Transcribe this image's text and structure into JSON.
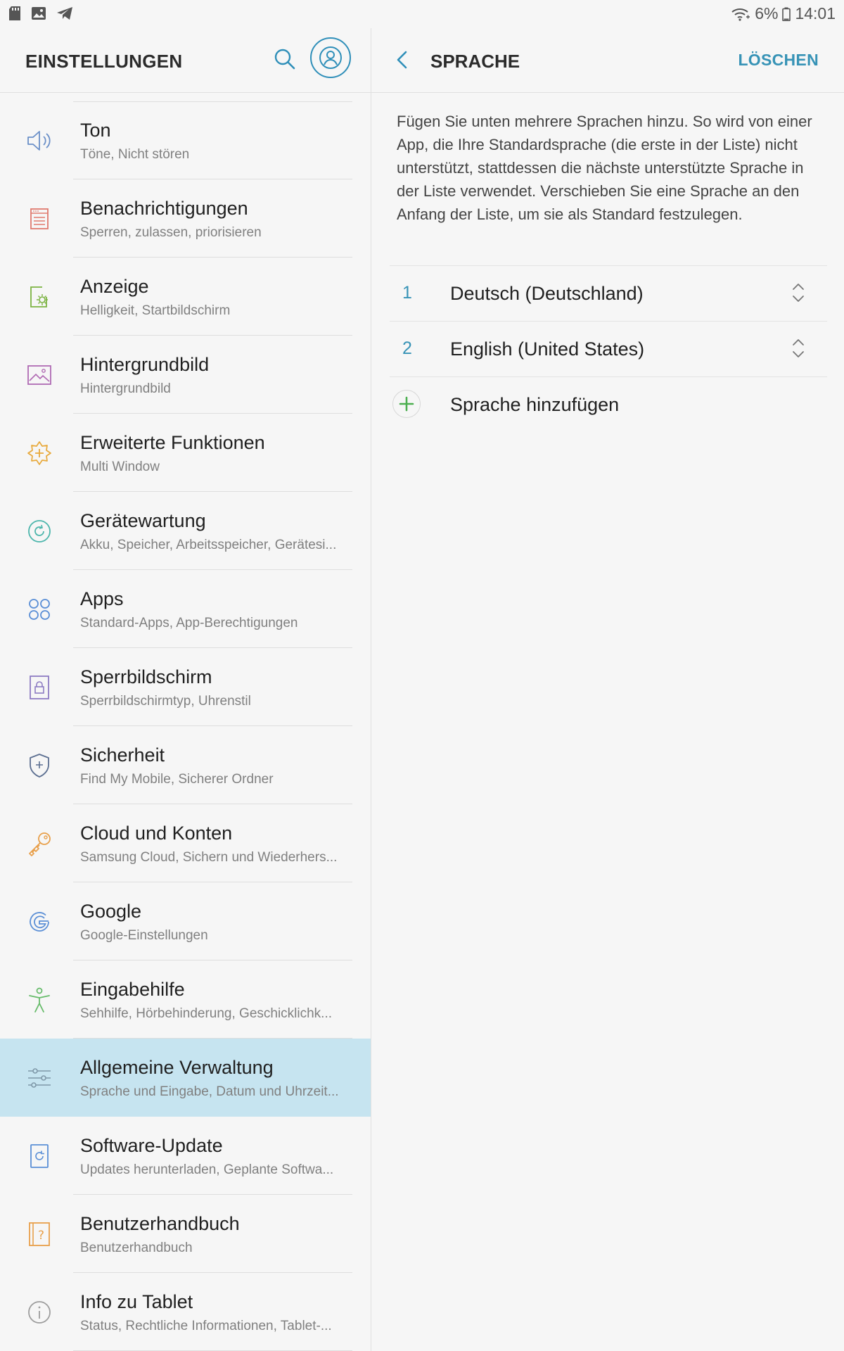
{
  "status_bar": {
    "battery": "6%",
    "time": "14:01",
    "left_icons": [
      "sd-card-icon",
      "gallery-icon",
      "telegram-icon"
    ]
  },
  "left_pane": {
    "title": "EINSTELLUNGEN",
    "items": [
      {
        "title": "Ton",
        "subtitle": "Töne, Nicht stören",
        "icon": "speaker-icon"
      },
      {
        "title": "Benachrichtigungen",
        "subtitle": "Sperren, zulassen, priorisieren",
        "icon": "notification-icon"
      },
      {
        "title": "Anzeige",
        "subtitle": "Helligkeit, Startbildschirm",
        "icon": "display-brightness-icon"
      },
      {
        "title": "Hintergrundbild",
        "subtitle": "Hintergrundbild",
        "icon": "wallpaper-icon"
      },
      {
        "title": "Erweiterte Funktionen",
        "subtitle": "Multi Window",
        "icon": "advanced-features-icon"
      },
      {
        "title": "Gerätewartung",
        "subtitle": "Akku, Speicher, Arbeitsspeicher, Gerätesi...",
        "icon": "device-maintenance-icon"
      },
      {
        "title": "Apps",
        "subtitle": "Standard-Apps, App-Berechtigungen",
        "icon": "apps-icon"
      },
      {
        "title": "Sperrbildschirm",
        "subtitle": "Sperrbildschirmtyp, Uhrenstil",
        "icon": "lock-screen-icon"
      },
      {
        "title": "Sicherheit",
        "subtitle": "Find My Mobile, Sicherer Ordner",
        "icon": "shield-icon"
      },
      {
        "title": "Cloud und Konten",
        "subtitle": "Samsung Cloud, Sichern und Wiederhers...",
        "icon": "key-icon"
      },
      {
        "title": "Google",
        "subtitle": "Google-Einstellungen",
        "icon": "google-icon"
      },
      {
        "title": "Eingabehilfe",
        "subtitle": "Sehhilfe, Hörbehinderung, Geschicklichk...",
        "icon": "accessibility-icon"
      },
      {
        "title": "Allgemeine Verwaltung",
        "subtitle": "Sprache und Eingabe, Datum und Uhrzeit...",
        "icon": "sliders-icon"
      },
      {
        "title": "Software-Update",
        "subtitle": "Updates herunterladen, Geplante Softwa...",
        "icon": "software-update-icon"
      },
      {
        "title": "Benutzerhandbuch",
        "subtitle": "Benutzerhandbuch",
        "icon": "user-manual-icon"
      },
      {
        "title": "Info zu Tablet",
        "subtitle": "Status, Rechtliche Informationen, Tablet-...",
        "icon": "info-icon"
      }
    ]
  },
  "right_pane": {
    "title": "SPRACHE",
    "delete_label": "LÖSCHEN",
    "description": "Fügen Sie unten mehrere Sprachen hinzu. So wird von einer App, die Ihre Standardsprache (die erste in der Liste) nicht unterstützt, stattdessen die nächste unterstützte Sprache in der Liste verwendet. Verschieben Sie eine Sprache an den Anfang der Liste, um sie als Standard festzulegen.",
    "languages": [
      {
        "number": "1",
        "name": "Deutsch (Deutschland)"
      },
      {
        "number": "2",
        "name": "English (United States)"
      }
    ],
    "add_label": "Sprache hinzufügen"
  },
  "colors": {
    "accent": "#3793b6",
    "selected_bg": "#c6e4f0",
    "add_green": "#4caf50"
  }
}
